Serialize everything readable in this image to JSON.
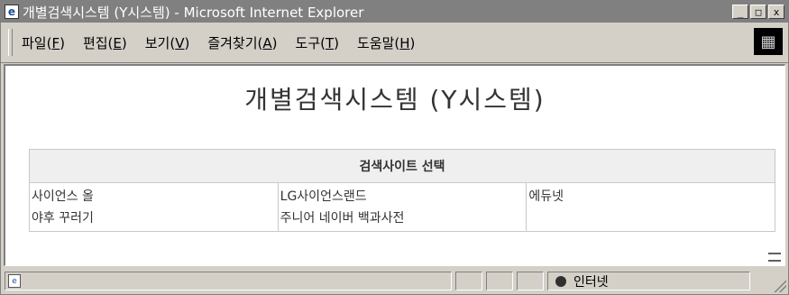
{
  "window": {
    "title": "개별검색시스템 (Y시스템) - Microsoft Internet Explorer",
    "minimize": "_",
    "maximize": "□",
    "close": "x"
  },
  "menu": {
    "items": [
      {
        "label": "파일(",
        "key": "F",
        "end": ")"
      },
      {
        "label": "편집(",
        "key": "E",
        "end": ")"
      },
      {
        "label": "보기(",
        "key": "V",
        "end": ")"
      },
      {
        "label": "즐겨찾기(",
        "key": "A",
        "end": ")"
      },
      {
        "label": "도구(",
        "key": "T",
        "end": ")"
      },
      {
        "label": "도움말(",
        "key": "H",
        "end": ")"
      }
    ]
  },
  "page": {
    "title": "개별검색시스템 (Y시스템)",
    "table_header": "검색사이트 선택",
    "columns": [
      [
        "사이언스 올",
        "야후 꾸러기"
      ],
      [
        "LG사이언스랜드",
        "주니어 네이버 백과사전"
      ],
      [
        "에듀넷"
      ]
    ]
  },
  "status": {
    "zone": "인터넷"
  },
  "icons": {
    "app": "ie-icon",
    "throbber": "windows-logo-icon",
    "page": "page-icon",
    "zone": "globe-icon"
  }
}
